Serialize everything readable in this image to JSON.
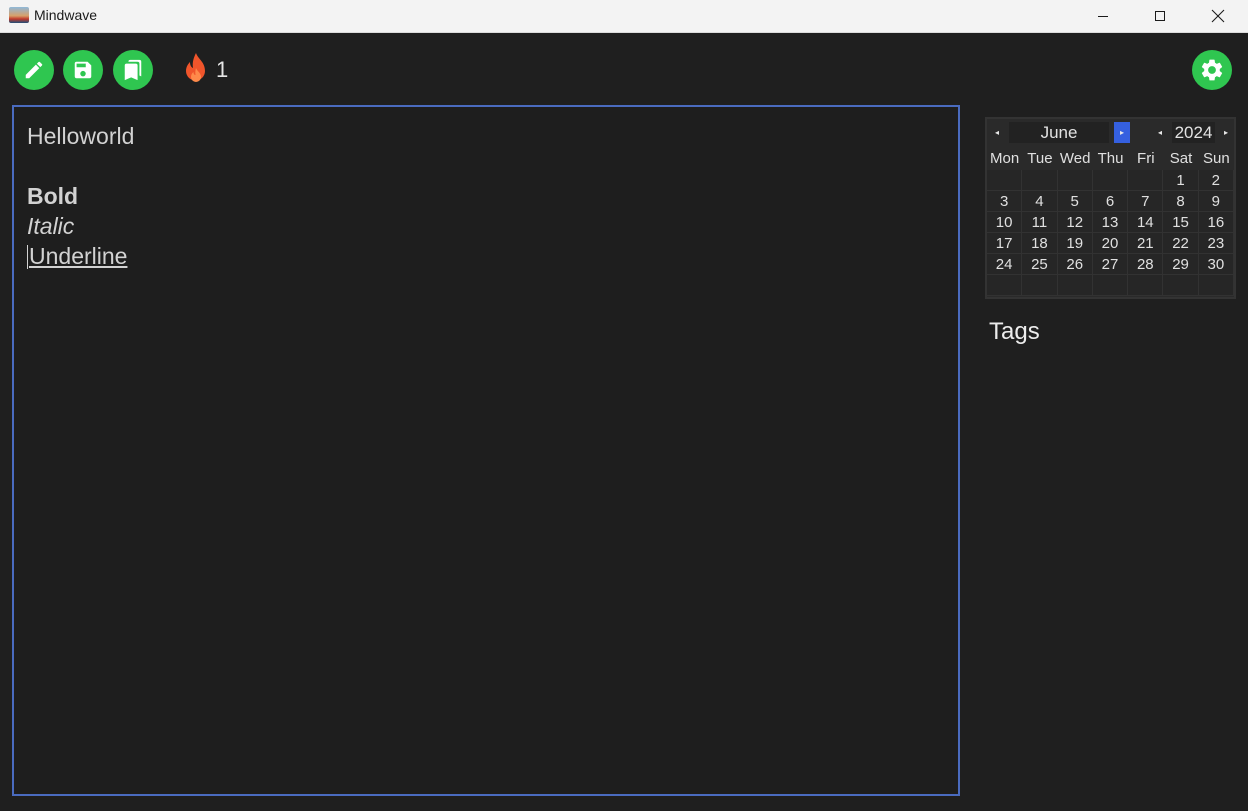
{
  "window": {
    "title": "Mindwave"
  },
  "toolbar": {
    "buttons": [
      "pencil-icon",
      "save-icon",
      "bookmarks-icon"
    ],
    "streak_icon": "fire-icon",
    "streak_count": "1",
    "settings_icon": "gear-icon",
    "accent_color": "#2fc650"
  },
  "editor": {
    "lines": [
      {
        "text": "Helloworld",
        "style": "normal"
      },
      {
        "text": "",
        "style": "normal"
      },
      {
        "text": "Bold",
        "style": "bold"
      },
      {
        "text": "Italic",
        "style": "italic"
      },
      {
        "text": "Underline",
        "style": "underline"
      }
    ],
    "border_color": "#4a6bbf"
  },
  "calendar": {
    "month": "June",
    "year": "2024",
    "weekdays": [
      "Mon",
      "Tue",
      "Wed",
      "Thu",
      "Fri",
      "Sat",
      "Sun"
    ],
    "weeks": [
      [
        "",
        "",
        "",
        "",
        "",
        "1",
        "2"
      ],
      [
        "3",
        "4",
        "5",
        "6",
        "7",
        "8",
        "9"
      ],
      [
        "10",
        "11",
        "12",
        "13",
        "14",
        "15",
        "16"
      ],
      [
        "17",
        "18",
        "19",
        "20",
        "21",
        "22",
        "23"
      ],
      [
        "24",
        "25",
        "26",
        "27",
        "28",
        "29",
        "30"
      ],
      [
        "",
        "",
        "",
        "",
        "",
        "",
        ""
      ]
    ],
    "active_arrow_color": "#3560e0"
  },
  "tags": {
    "title": "Tags"
  }
}
